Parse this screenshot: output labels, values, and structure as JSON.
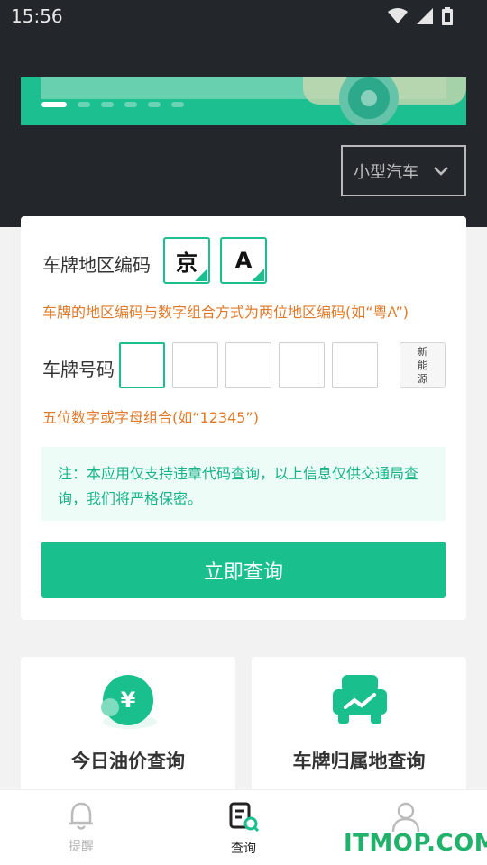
{
  "status_bar": {
    "time": "15:56"
  },
  "vehicle_type": {
    "selected": "小型汽车"
  },
  "form": {
    "region_label": "车牌地区编码",
    "region_province": "京",
    "region_letter": "A",
    "region_hint": "车牌的地区编码与数字组合方式为两位地区编码(如“粤A”)",
    "plate_label": "车牌号码",
    "new_energy_lines": [
      "新",
      "能",
      "源"
    ],
    "plate_hint": "五位数字或字母组合(如“12345”)",
    "note": "注：本应用仅支持违章代码查询，以上信息仅供交通局查询，我们将严格保密。",
    "submit_label": "立即查询"
  },
  "services": [
    {
      "title": "今日油价查询"
    },
    {
      "title": "车牌归属地查询"
    }
  ],
  "nav": {
    "items": [
      {
        "label": "提醒"
      },
      {
        "label": "查询"
      },
      {
        "label": ""
      }
    ]
  },
  "watermark": "ITMOP.COM",
  "colors": {
    "accent": "#19c08e",
    "hint": "#e07a2a",
    "dark_header": "#23262b"
  }
}
